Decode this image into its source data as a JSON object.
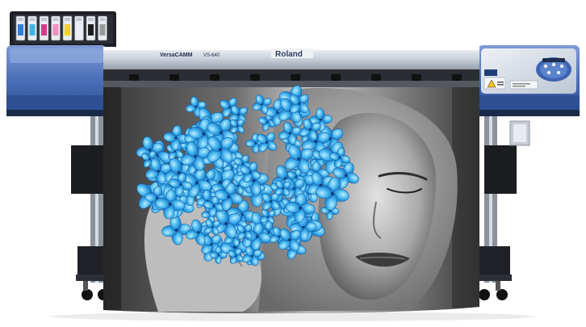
{
  "brand": {
    "name": "Roland",
    "model_series": "VersaCAMM",
    "model_code": "VS-640"
  },
  "ink_cartridge_colors": [
    "#2f7fd8",
    "#3fb6e6",
    "#d43a8c",
    "#f08fc0",
    "#f2d51a",
    "#e9eef2",
    "#1e1e1e",
    "#9a9a9a"
  ],
  "colors": {
    "body_blue": "#4a6fb8",
    "body_blue_dark": "#2d4f94",
    "body_silver": "#d7dde6",
    "frame_dark": "#2a2d33",
    "print_accent": "#2aa7e6"
  },
  "icons": {
    "control_panel": "control-panel-icon",
    "warning": "warning-label-icon"
  }
}
